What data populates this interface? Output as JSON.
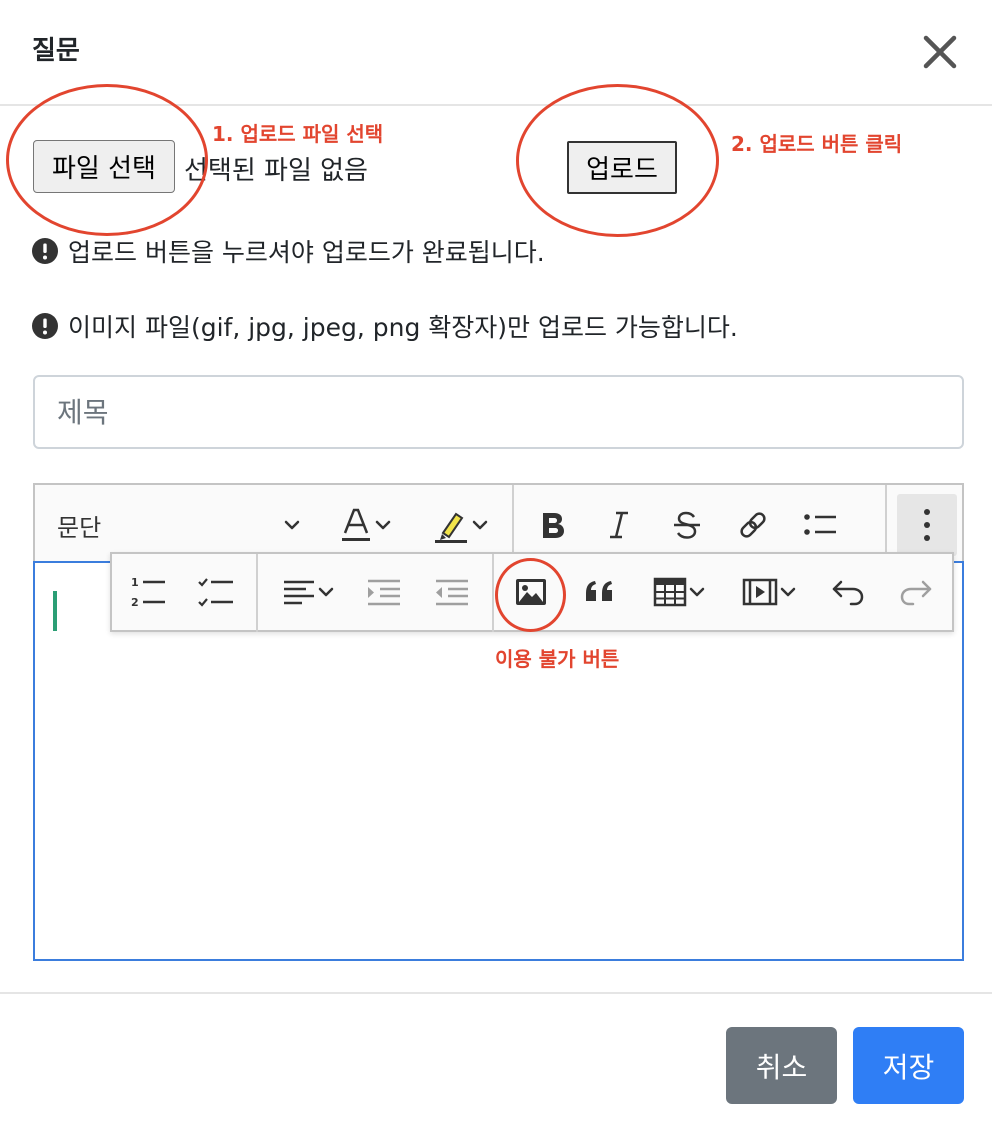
{
  "header": {
    "title": "질문",
    "close_icon": "close-icon"
  },
  "upload": {
    "file_button_label": "파일 선택",
    "file_status": "선택된 파일 없음",
    "upload_button_label": "업로드"
  },
  "annotations": {
    "step1": "1. 업로드 파일 선택",
    "step2": "2. 업로드 버튼 클릭",
    "unavailable": "이용 불가 버튼",
    "color": "#e2452f"
  },
  "notices": [
    {
      "icon": "exclamation-circle-icon",
      "text": "업로드 버튼을 누르셔야 업로드가 완료됩니다."
    },
    {
      "icon": "exclamation-circle-icon",
      "text": "이미지 파일(gif, jpg, jpeg, png 확장자)만 업로드 가능합니다."
    }
  ],
  "form": {
    "title_placeholder": "제목"
  },
  "editor": {
    "heading_value": "문단",
    "toolbar_icons": [
      "font-color-icon",
      "highlight-icon",
      "bold-icon",
      "italic-icon",
      "strikethrough-icon",
      "link-icon",
      "bulleted-list-icon",
      "more-vertical-icon"
    ],
    "overflow_icons": [
      "numbered-list-icon",
      "todo-list-icon",
      "align-icon",
      "indent-icon",
      "outdent-icon",
      "insert-image-icon",
      "block-quote-icon",
      "insert-table-icon",
      "insert-media-icon",
      "undo-icon",
      "redo-icon"
    ],
    "accent_color": "#3b7ddd"
  },
  "footer": {
    "cancel_label": "취소",
    "save_label": "저장"
  },
  "colors": {
    "cancel": "#6c757d",
    "save": "#2f7ef5"
  }
}
